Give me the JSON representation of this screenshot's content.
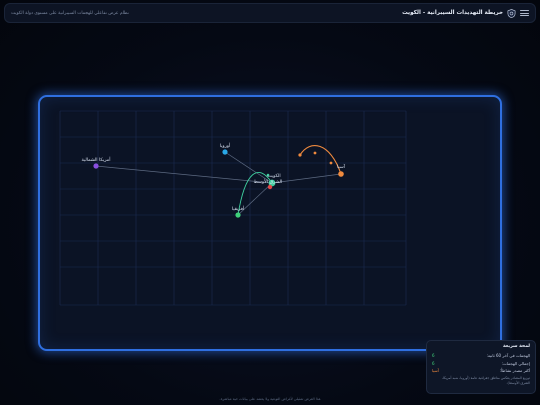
{
  "header": {
    "title": "خريطة التهديدات السيبرانية - الكويت",
    "subtitle": "نظام عرض تفاعلي للهجمات السيبرانية على مستوى دولة الكويت",
    "menu_icon": "menu-icon",
    "logo_icon": "shield-logo-icon"
  },
  "map": {
    "nodes": [
      {
        "id": "kuwait",
        "label": "الكويت",
        "color": "#3fd0a0"
      },
      {
        "id": "americas",
        "label": "أمريكا الشمالية",
        "color": "#8a4fe0"
      },
      {
        "id": "europe",
        "label": "أوروبا",
        "color": "#2aa8e8"
      },
      {
        "id": "asia",
        "label": "آسيا",
        "color": "#f08a3e"
      },
      {
        "id": "mideast",
        "label": "الشرق الأوسط",
        "color": "#e04848"
      },
      {
        "id": "africa",
        "label": "أفريقيا",
        "color": "#3fd07a"
      }
    ]
  },
  "sidepanel": {
    "title": "لمحة سريعة",
    "rows": [
      {
        "label": "الهجمات في آخر 60 ثانية:",
        "value": "6"
      },
      {
        "label": "إجمالي الهجمات:",
        "value": "6"
      },
      {
        "label": "أكثر مصدر نشاطاً:",
        "value": "آسيا"
      }
    ],
    "note": "توزيع المصادر يعكس مناطق جغرافية عامة (أوروبا، شبه أمريكا، الشرق الأوسط)."
  },
  "footer": {
    "text": "هذا العرض تمثيلي لأغراض التوعية ولا يعتمد على بيانات حية مباشرة."
  },
  "colors": {
    "accent": "#2f6fe0",
    "grid": "#1b2c52",
    "attack_green": "#3fd0a0",
    "attack_orange": "#f08a3e"
  }
}
